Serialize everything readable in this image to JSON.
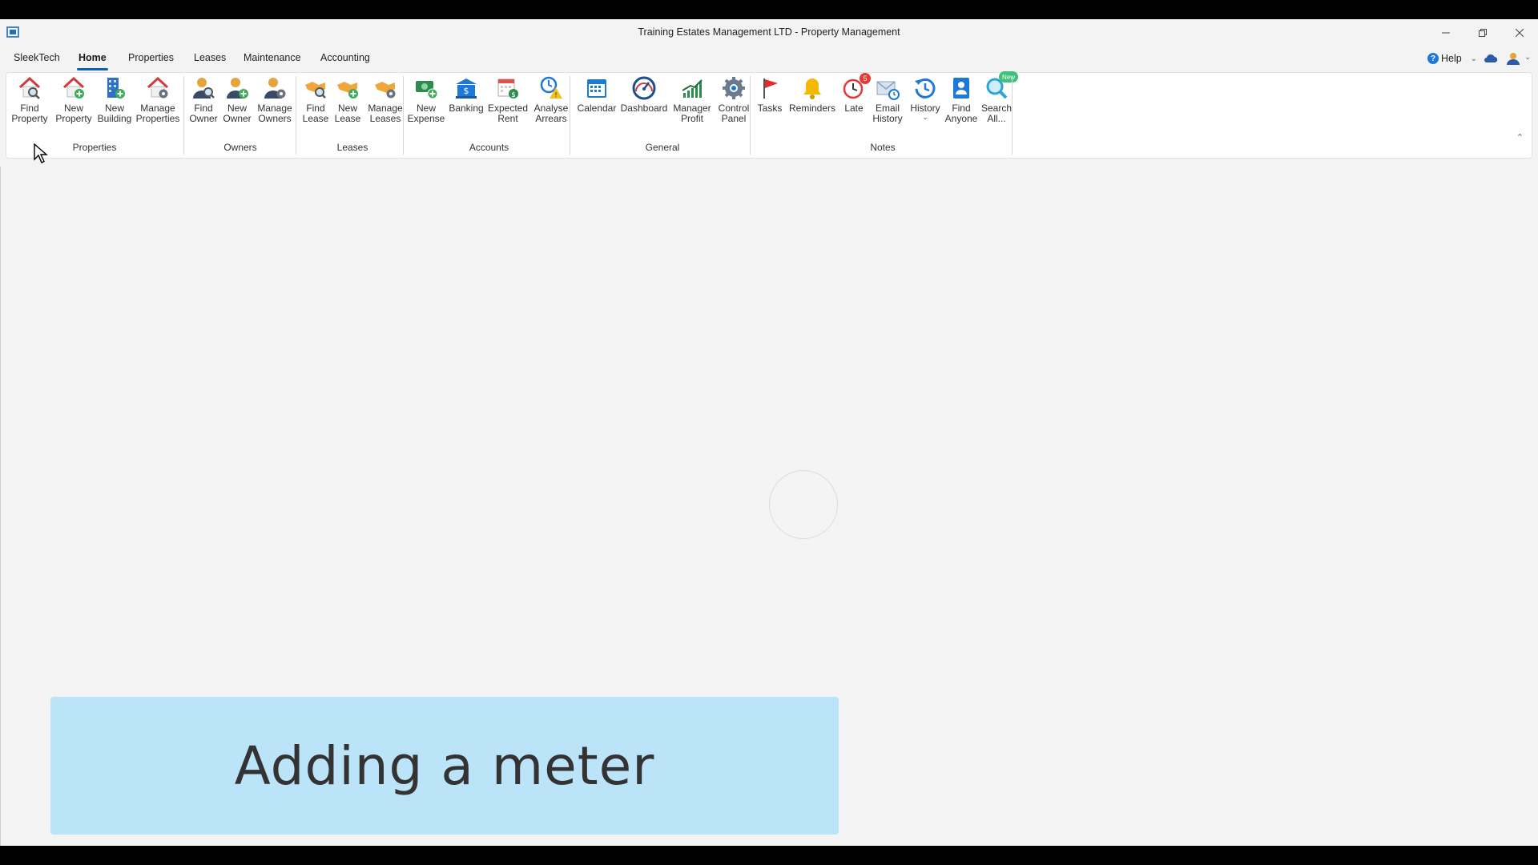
{
  "window": {
    "title": "Training Estates Management LTD - Property Management"
  },
  "menu": {
    "tabs": [
      {
        "label": "SleekTech"
      },
      {
        "label": "Home",
        "active": true
      },
      {
        "label": "Properties"
      },
      {
        "label": "Leases"
      },
      {
        "label": "Maintenance"
      },
      {
        "label": "Accounting"
      }
    ],
    "help_label": "Help"
  },
  "ribbon": {
    "groups": {
      "properties": {
        "label": "Properties",
        "buttons": [
          "Find\nProperty",
          "New\nProperty",
          "New\nBuilding",
          "Manage\nProperties"
        ]
      },
      "owners": {
        "label": "Owners",
        "buttons": [
          "Find\nOwner",
          "New\nOwner",
          "Manage\nOwners"
        ]
      },
      "leases": {
        "label": "Leases",
        "buttons": [
          "Find\nLease",
          "New\nLease",
          "Manage\nLeases"
        ]
      },
      "accounts": {
        "label": "Accounts",
        "buttons": [
          "New\nExpense",
          "Banking",
          "Expected\nRent",
          "Analyse\nArrears"
        ]
      },
      "general": {
        "label": "General",
        "buttons": [
          "Calendar",
          "Dashboard",
          "Manager\nProfit",
          "Control\nPanel"
        ]
      },
      "notes": {
        "label": "Notes",
        "buttons": [
          "Tasks",
          "Reminders",
          "Late",
          "Email\nHistory",
          "History",
          "Find\nAnyone",
          "Search\nAll..."
        ],
        "late_badge": "5",
        "search_badge": "New"
      }
    }
  },
  "caption": {
    "text": "Adding a meter"
  },
  "colors": {
    "accent": "#0a5ec4",
    "caption_bg": "#bce4f9",
    "badge_red": "#e53935",
    "badge_green": "#3ec27a"
  }
}
